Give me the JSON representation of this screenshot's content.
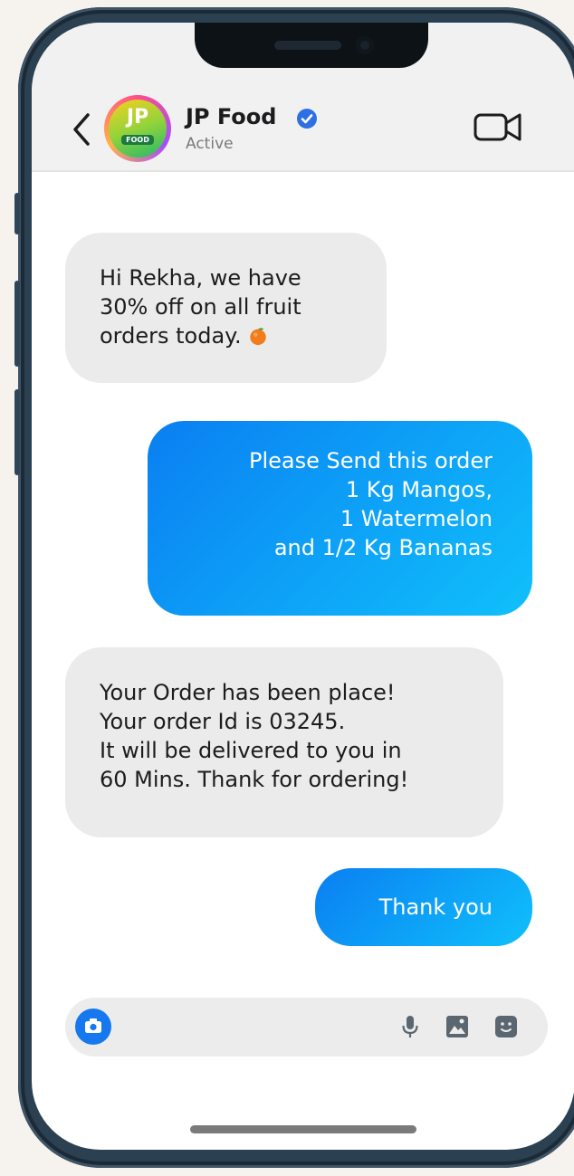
{
  "header": {
    "avatar_initials": "JP",
    "avatar_tag": "FOOD",
    "contact_name": "JP Food",
    "status": "Active"
  },
  "messages": [
    {
      "direction": "incoming",
      "lines": [
        "Hi Rekha, we have",
        "30% off on all fruit",
        "orders today."
      ],
      "trailing_icon": "orange-icon"
    },
    {
      "direction": "outgoing",
      "lines": [
        "Please Send this order",
        "1 Kg Mangos,",
        "1 Watermelon",
        "and 1/2 Kg Bananas"
      ]
    },
    {
      "direction": "incoming",
      "lines": [
        "Your Order has been place!",
        "Your order Id is 03245.",
        "It will be delivered to you in",
        "60 Mins. Thank for ordering!"
      ]
    },
    {
      "direction": "outgoing",
      "lines": [
        "Thank you"
      ]
    }
  ],
  "composer": {
    "icons": [
      "camera-icon",
      "microphone-icon",
      "gallery-icon",
      "sticker-icon"
    ]
  },
  "colors": {
    "accent": "#0a7ff2",
    "accent_light": "#10c0fb",
    "incoming_bubble": "#ebebeb",
    "header_bg": "#f1f1f1",
    "verified": "#2f6fe4",
    "frame": "#2b4051",
    "page_bg": "#f6f3ee"
  }
}
